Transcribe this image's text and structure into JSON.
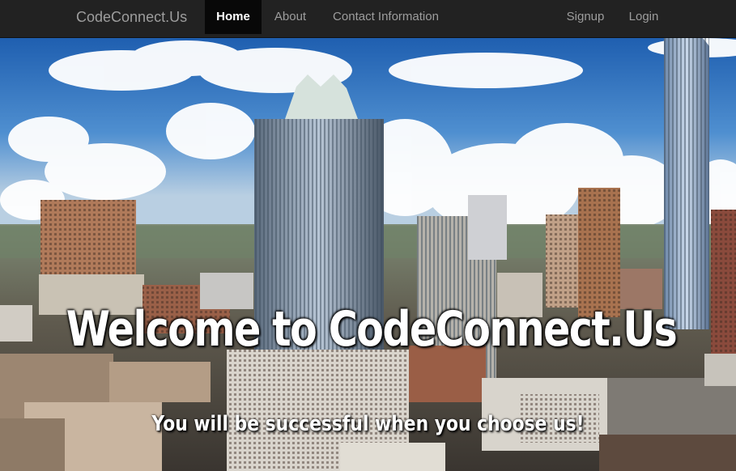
{
  "navbar": {
    "brand": "CodeConnect.Us",
    "items": [
      {
        "label": "Home",
        "active": true
      },
      {
        "label": "About"
      },
      {
        "label": "Contact Information"
      }
    ],
    "right_items": [
      {
        "label": "Signup"
      },
      {
        "label": "Login"
      }
    ]
  },
  "hero": {
    "title": "Welcome to CodeConnect.Us",
    "subtitle": "You will be successful when you choose us!"
  }
}
